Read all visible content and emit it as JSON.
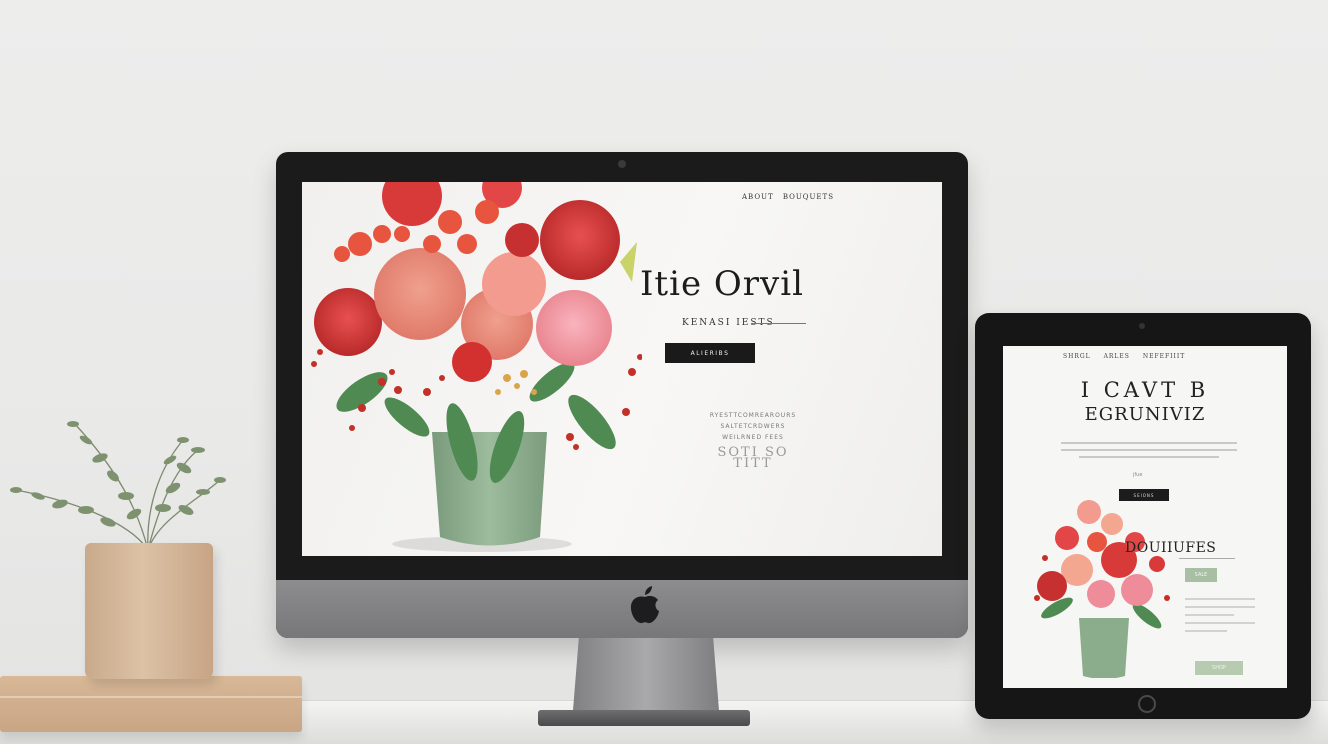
{
  "scene": {
    "description_label": "Floral website mockup on iMac and iPad"
  },
  "imac": {
    "nav_left": "ABOUT",
    "nav_right": "BOUQUETS",
    "hero_title": "Itie Orvil",
    "hero_subtitle": "KENASI IESTS",
    "hero_button": "ALIERIBS",
    "info_lines": [
      "RYESTTCOMREAROURS",
      "SALTETCRDWERS",
      "WEILRNED FEES"
    ],
    "info_big": "SOTI SO TITT"
  },
  "ipad": {
    "nav_items": [
      "SHRGL",
      "ARLES",
      "NEFEFIIIT"
    ],
    "title_line1": "I CAVT B",
    "title_line2": "EGRUNIVIZ",
    "small_text": "jfue",
    "button": "SEIONS",
    "section_heading": "DOUIIUFES",
    "tag": "SALE",
    "cta": "SHOP"
  },
  "colors": {
    "accent_sage": "#a8bfa3",
    "bezel": "#1b1b1c",
    "chin": "#858587",
    "pot_terracotta": "#d6b99c",
    "vase_green": "#8cad8c",
    "flower_red": "#d83a3a",
    "flower_pink": "#ee8d99",
    "flower_peach": "#f3a690"
  },
  "icons": {
    "apple": "apple-logo-icon",
    "camera": "camera-icon",
    "home": "home-button-icon"
  }
}
